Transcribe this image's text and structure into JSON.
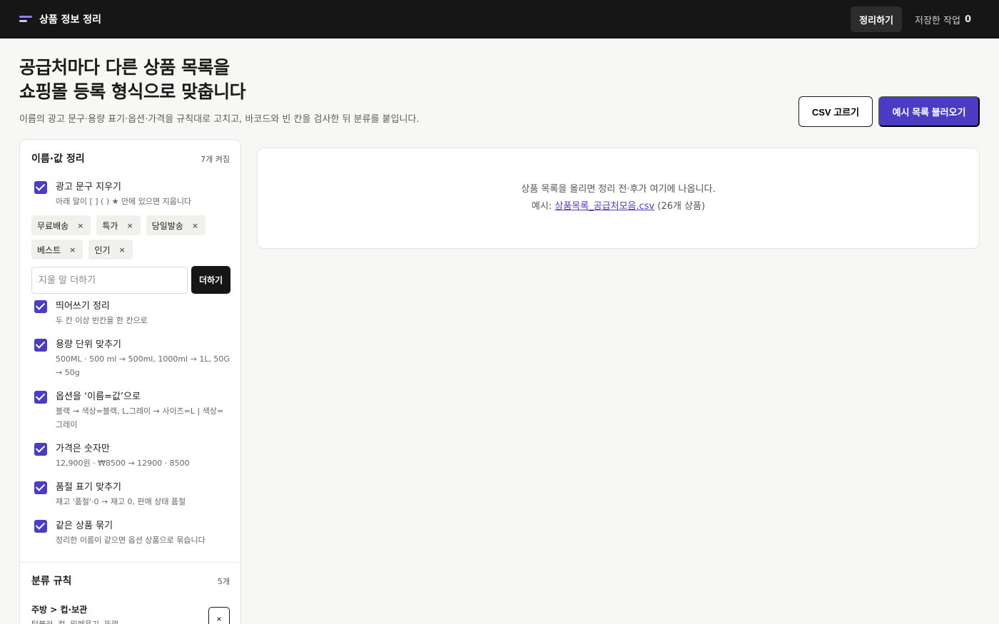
{
  "app": {
    "title": "상품 정보 정리"
  },
  "nav": {
    "tidy_label": "정리하기",
    "saved_label": "저장한 작업",
    "saved_count": "0"
  },
  "hero": {
    "title_line1": "공급처마다 다른 상품 목록을",
    "title_line2": "쇼핑몰 등록 형식으로 맞춥니다",
    "subtitle": "이름의 광고 문구·용량 표기·옵션·가격을 규칙대로 고치고, 바코드와 빈 칸을 검사한 뒤 분류를 붙입니다.",
    "csv_button": "CSV 고르기",
    "sample_button": "예시 목록 불러오기"
  },
  "cleanup": {
    "title": "이름·값 정리",
    "meta": "7개 켜짐",
    "ad_words": {
      "label": "광고 문구 지우기",
      "desc": "아래 말이 [ ] ( ) ★ 안에 있으면 지웁니다",
      "chips": [
        "무료배송",
        "특가",
        "당일발송",
        "베스트",
        "인기"
      ],
      "chip_remove": "×",
      "input_placeholder": "지울 말 더하기",
      "add_button": "더하기"
    },
    "options": [
      {
        "label": "띄어쓰기 정리",
        "desc": "두 칸 이상 빈칸을 한 칸으로",
        "checked": true
      },
      {
        "label": "용량 단위 맞추기",
        "desc": "500ML · 500 ml → 500ml, 1000ml → 1L, 50G → 50g",
        "checked": true
      },
      {
        "label": "옵션을 ‘이름=값’으로",
        "desc": "블랙 → 색상=블랙, L,그레이 → 사이즈=L | 색상=그레이",
        "checked": true
      },
      {
        "label": "가격은 숫자만",
        "desc": "12,900원 · ₩8500 → 12900 · 8500",
        "checked": true
      },
      {
        "label": "품절 표기 맞추기",
        "desc": "재고 '품절'·0 → 재고 0, 판매 상태 품절",
        "checked": true
      },
      {
        "label": "같은 상품 묶기",
        "desc": "정리한 이름이 같으면 옵션 상품으로 묶습니다",
        "checked": true
      }
    ]
  },
  "categories": {
    "title": "분류 규칙",
    "meta": "5개",
    "first_rule": {
      "name": "주방 > 컵·보관",
      "desc": "텀블러, 컵, 밀폐용기, 뚜껑",
      "remove": "×"
    }
  },
  "preview": {
    "line1": "상품 목록을 올리면 정리 전·후가 여기에 나옵니다.",
    "example_prefix": "예시:",
    "example_link": "상품목록_공급처모음.csv",
    "example_suffix": "(26개 상품)"
  }
}
